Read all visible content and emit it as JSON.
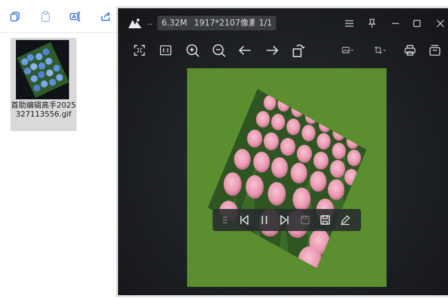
{
  "file": {
    "name": "首助编辑高手2025327113556.gif"
  },
  "viewer": {
    "file_size": "6.32M",
    "dimensions": "1917*2107像素",
    "page": "1/1",
    "dots": ".."
  },
  "icons": {
    "explorer_toolbar": [
      "copy-icon",
      "paste-icon",
      "rename-icon",
      "share-icon"
    ],
    "titlebar": [
      "app-logo-icon",
      "menu-icon",
      "pin-icon",
      "minimize-icon",
      "maximize-icon",
      "close-icon"
    ],
    "toolbar": [
      "fit-screen-icon",
      "actual-size-icon",
      "zoom-in-icon",
      "zoom-out-icon",
      "prev-icon",
      "next-icon",
      "rotate-icon",
      "image-edit-icon",
      "crop-icon",
      "print-icon",
      "more-icon"
    ],
    "playbar": [
      "list-icon",
      "first-frame-icon",
      "pause-icon",
      "last-frame-icon",
      "save-frame-icon",
      "save-icon",
      "edit-icon"
    ]
  },
  "colors": {
    "accent": "#2a6fd6",
    "viewer_bg": "#1e2124",
    "image_bg": "#5b8e2e",
    "tulip": "#eaa0b4"
  }
}
